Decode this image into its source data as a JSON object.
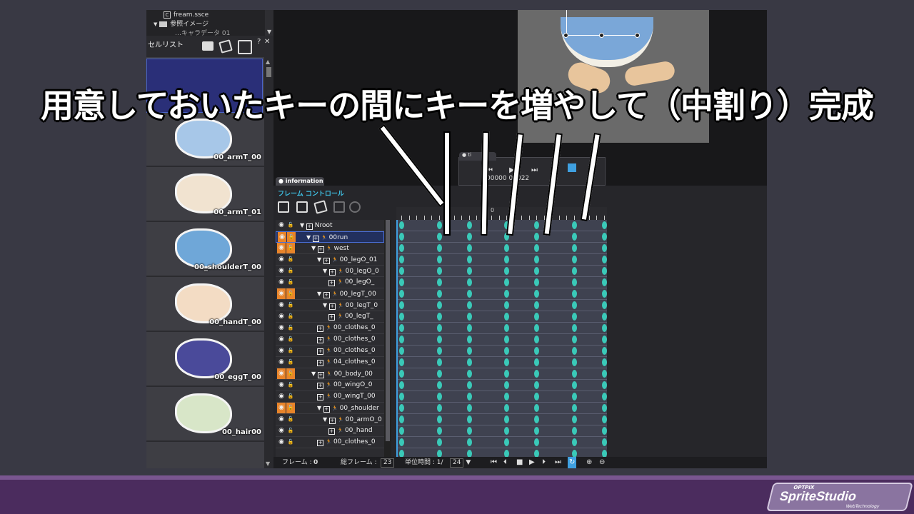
{
  "caption": "用意しておいたキーの間にキーを増やして（中割り）完成",
  "tree": {
    "file": "fream.ssce",
    "folder": "参照イメージ",
    "partial": "…キャラデータ 01"
  },
  "cell_list": {
    "title": "セルリスト",
    "help": "?",
    "close": "✕",
    "cells": [
      {
        "label": "",
        "color": "#2a2f78"
      },
      {
        "label": "00_armT_00",
        "color": "#a7c7e8"
      },
      {
        "label": "00_armT_01",
        "color": "#f1e3d0"
      },
      {
        "label": "00_shoulderT_00",
        "color": "#6fa7d8"
      },
      {
        "label": "00_handT_00",
        "color": "#f3dcc4"
      },
      {
        "label": "00_eggT_00",
        "color": "#4a4a9a"
      },
      {
        "label": "00_hair00",
        "color": "#d8e6c8"
      }
    ]
  },
  "timeline_popup": {
    "tab": "● ti",
    "frame_start": "00000",
    "frame_end": "00022"
  },
  "info_panel": {
    "tab": "● information",
    "title": "フレーム コントロール",
    "ruler_zero": "0"
  },
  "layers": [
    {
      "name": "root",
      "prefix": "N",
      "indent": 0,
      "arrow": "▼",
      "orange": false,
      "highlight": false
    },
    {
      "name": "00run",
      "prefix": "",
      "indent": 1,
      "arrow": "▼",
      "orange": true,
      "highlight": true
    },
    {
      "name": "west",
      "prefix": "",
      "indent": 2,
      "arrow": "▼",
      "orange": true,
      "highlight": false
    },
    {
      "name": "00_legO_01",
      "prefix": "",
      "indent": 3,
      "arrow": "▼",
      "orange": false,
      "highlight": false
    },
    {
      "name": "00_legO_0",
      "prefix": "",
      "indent": 4,
      "arrow": "▼",
      "orange": false,
      "highlight": false
    },
    {
      "name": "00_legO_",
      "prefix": "",
      "indent": 5,
      "arrow": "",
      "orange": false,
      "highlight": false
    },
    {
      "name": "00_legT_00",
      "prefix": "",
      "indent": 3,
      "arrow": "▼",
      "orange": true,
      "highlight": false
    },
    {
      "name": "00_legT_0",
      "prefix": "",
      "indent": 4,
      "arrow": "▼",
      "orange": false,
      "highlight": false
    },
    {
      "name": "00_legT_",
      "prefix": "",
      "indent": 5,
      "arrow": "",
      "orange": false,
      "highlight": false
    },
    {
      "name": "00_clothes_0",
      "prefix": "",
      "indent": 3,
      "arrow": "",
      "orange": false,
      "highlight": false
    },
    {
      "name": "00_clothes_0",
      "prefix": "",
      "indent": 3,
      "arrow": "",
      "orange": false,
      "highlight": false
    },
    {
      "name": "00_clothes_0",
      "prefix": "",
      "indent": 3,
      "arrow": "",
      "orange": false,
      "highlight": false
    },
    {
      "name": "04_clothes_0",
      "prefix": "",
      "indent": 3,
      "arrow": "",
      "orange": false,
      "highlight": false
    },
    {
      "name": "00_body_00",
      "prefix": "",
      "indent": 2,
      "arrow": "▼",
      "orange": true,
      "highlight": false
    },
    {
      "name": "00_wingO_0",
      "prefix": "",
      "indent": 3,
      "arrow": "",
      "orange": false,
      "highlight": false
    },
    {
      "name": "00_wingT_00",
      "prefix": "",
      "indent": 3,
      "arrow": "",
      "orange": false,
      "highlight": false
    },
    {
      "name": "00_shoulder",
      "prefix": "",
      "indent": 3,
      "arrow": "▼",
      "orange": true,
      "highlight": false
    },
    {
      "name": "00_armO_0",
      "prefix": "",
      "indent": 4,
      "arrow": "▼",
      "orange": false,
      "highlight": false
    },
    {
      "name": "00_hand",
      "prefix": "",
      "indent": 5,
      "arrow": "",
      "orange": false,
      "highlight": false
    },
    {
      "name": "00_clothes_0",
      "prefix": "",
      "indent": 3,
      "arrow": "",
      "orange": false,
      "highlight": false
    }
  ],
  "key_columns": [
    0,
    5,
    9,
    14,
    18,
    23,
    27
  ],
  "status": {
    "frame_label": "フレーム :",
    "frame_value": "0",
    "total_label": "総フレーム :",
    "total_value": "23",
    "unit_label": "単位時間 : 1/",
    "unit_value": "24"
  },
  "brand": {
    "small": "OPTPIX",
    "name": "SpriteStudio",
    "sub": "WebTechnology"
  },
  "colors": {
    "key": "#3ac9b8",
    "accent": "#3fc4e8",
    "highlight_orange": "#e8842a",
    "brand_purple": "#4b2c5e"
  }
}
